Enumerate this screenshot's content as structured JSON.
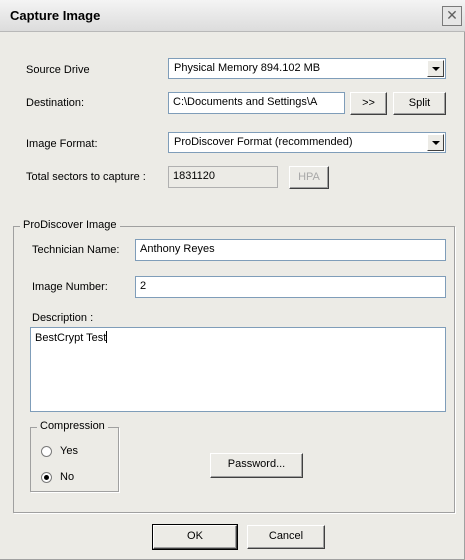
{
  "window": {
    "title": "Capture Image",
    "close_symbol": "✕"
  },
  "source_drive": {
    "label": "Source Drive",
    "value": "Physical Memory 894.102 MB"
  },
  "destination": {
    "label": "Destination:",
    "value": "C:\\Documents and Settings\\A",
    "browse_label": ">>",
    "split_label": "Split"
  },
  "image_format": {
    "label": "Image Format:",
    "value": "ProDiscover Format (recommended)"
  },
  "total_sectors": {
    "label": "Total sectors to capture :",
    "value": "1831120",
    "hpa_label": "HPA"
  },
  "prodiscover_image": {
    "group_title": "ProDiscover Image",
    "technician_label": "Technician Name:",
    "technician_value": "Anthony Reyes",
    "image_number_label": "Image Number:",
    "image_number_value": "2",
    "description_label": "Description :",
    "description_value": "BestCrypt Test"
  },
  "compression": {
    "group_title": "Compression",
    "yes_label": "Yes",
    "no_label": "No",
    "selected": "No"
  },
  "buttons": {
    "password_label": "Password...",
    "ok_label": "OK",
    "cancel_label": "Cancel"
  }
}
